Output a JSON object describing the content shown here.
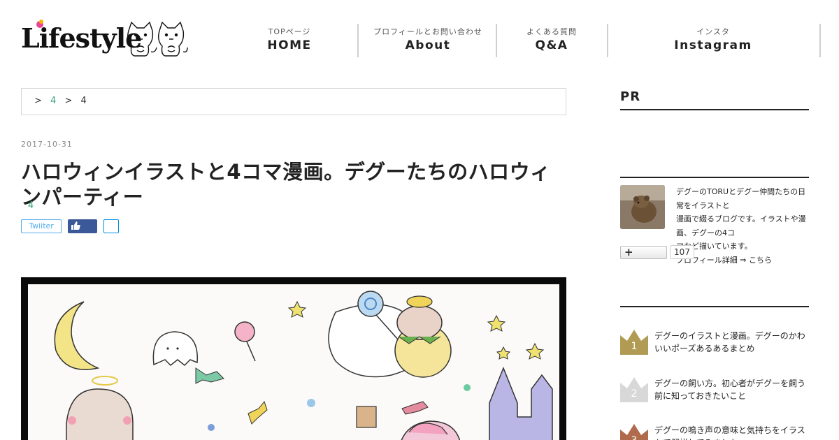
{
  "logo": {
    "text": "Lifestyle"
  },
  "nav": [
    {
      "sub": "TOPページ",
      "main": "HOME"
    },
    {
      "sub": "プロフィールとお問い合わせ",
      "main": "About"
    },
    {
      "sub": "よくある質問",
      "main": "Q&A"
    },
    {
      "sub": "インスタ",
      "main": "Instagram"
    }
  ],
  "breadcrumb": {
    "items": [
      ">",
      "4",
      ">",
      "4"
    ]
  },
  "post": {
    "date": "2017-10-31",
    "title": "ハロウィンイラストと4コマ漫画。デグーたちのハロウィンパーティー",
    "category": "4",
    "share_twitter": "Twiiter"
  },
  "sidebar": {
    "pr_heading": "PR",
    "profile": {
      "line1": "デグーのTORUとデグー仲間たちの日常をイラストと",
      "line2": "漫画で綴るブログです。イラストや漫画、デグーの4コ",
      "line3": "マなど描いています。",
      "link": "プロフィール詳細 ⇒ こちら"
    },
    "follow_label": "+",
    "follow_count": "107",
    "ranking": [
      {
        "rank": "1",
        "title": "デグーのイラストと漫画。デグーのかわいいポーズあるあるまとめ"
      },
      {
        "rank": "2",
        "title": "デグーの飼い方。初心者がデグーを飼う前に知っておきたいこと"
      },
      {
        "rank": "3",
        "title": "デグーの鳴き声の意味と気持ちをイラストで解説してみました"
      }
    ]
  },
  "colors": {
    "accent": "#3aa57a",
    "twitter": "#55acee",
    "facebook": "#3b5998",
    "hatena": "#008fde",
    "rank_gold": "#b19a53",
    "rank_silver": "#d8d8d8",
    "rank_bronze": "#b06b4c"
  }
}
